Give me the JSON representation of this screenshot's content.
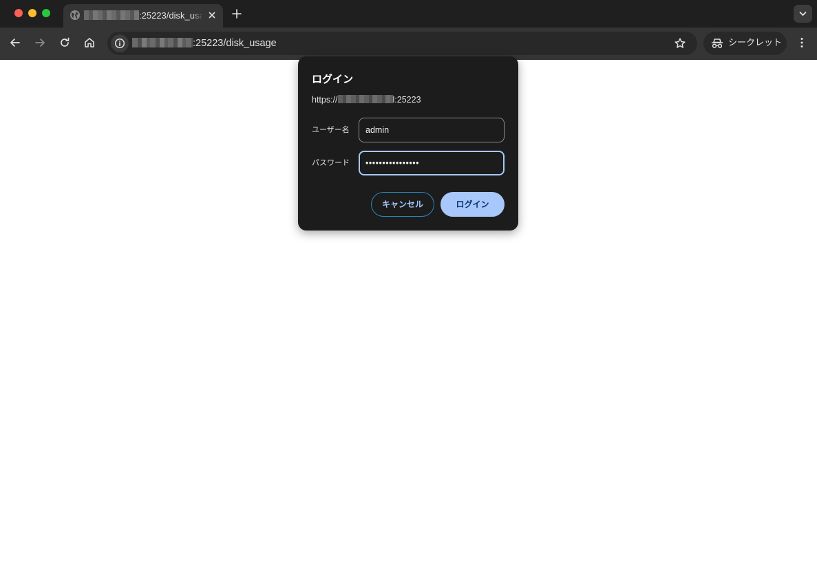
{
  "browser": {
    "tab": {
      "title_suffix": ":25223/disk_usa"
    },
    "omnibox": {
      "url_suffix": ":25223/disk_usage"
    },
    "incognito_label": "シークレット"
  },
  "dialog": {
    "title": "ログイン",
    "origin_prefix": "https://",
    "origin_suffix": "l:25223",
    "username_label": "ユーザー名",
    "username_value": "admin",
    "password_label": "パスワード",
    "password_value": "••••••••••••••••",
    "cancel_label": "キャンセル",
    "login_label": "ログイン"
  },
  "colors": {
    "accent": "#a8c7fa",
    "dialog_bg": "#1c1c1c",
    "toolbar_bg": "#353535",
    "tabstrip_bg": "#1f1f1f"
  }
}
